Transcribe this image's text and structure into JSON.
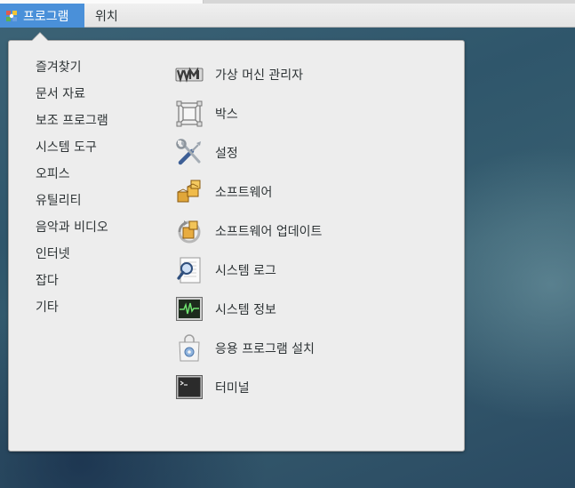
{
  "topbar": {
    "applications_label": "프로그램",
    "places_label": "위치"
  },
  "categories": [
    "즐겨찾기",
    "문서 자료",
    "보조 프로그램",
    "시스템 도구",
    "오피스",
    "유틸리티",
    "음악과 비디오",
    "인터넷",
    "잡다",
    "기타"
  ],
  "apps": [
    {
      "label": "가상 머신 관리자",
      "icon": "vmm-icon"
    },
    {
      "label": "박스",
      "icon": "boxes-icon"
    },
    {
      "label": "설정",
      "icon": "settings-icon"
    },
    {
      "label": "소프트웨어",
      "icon": "software-icon"
    },
    {
      "label": "소프트웨어 업데이트",
      "icon": "software-update-icon"
    },
    {
      "label": "시스템 로그",
      "icon": "system-log-icon"
    },
    {
      "label": "시스템 정보",
      "icon": "system-monitor-icon"
    },
    {
      "label": "응용 프로그램 설치",
      "icon": "package-installer-icon"
    },
    {
      "label": "터미널",
      "icon": "terminal-icon"
    }
  ],
  "colors": {
    "accent": "#4a90d9",
    "menu_bg": "#ededed",
    "text": "#2e3436"
  }
}
